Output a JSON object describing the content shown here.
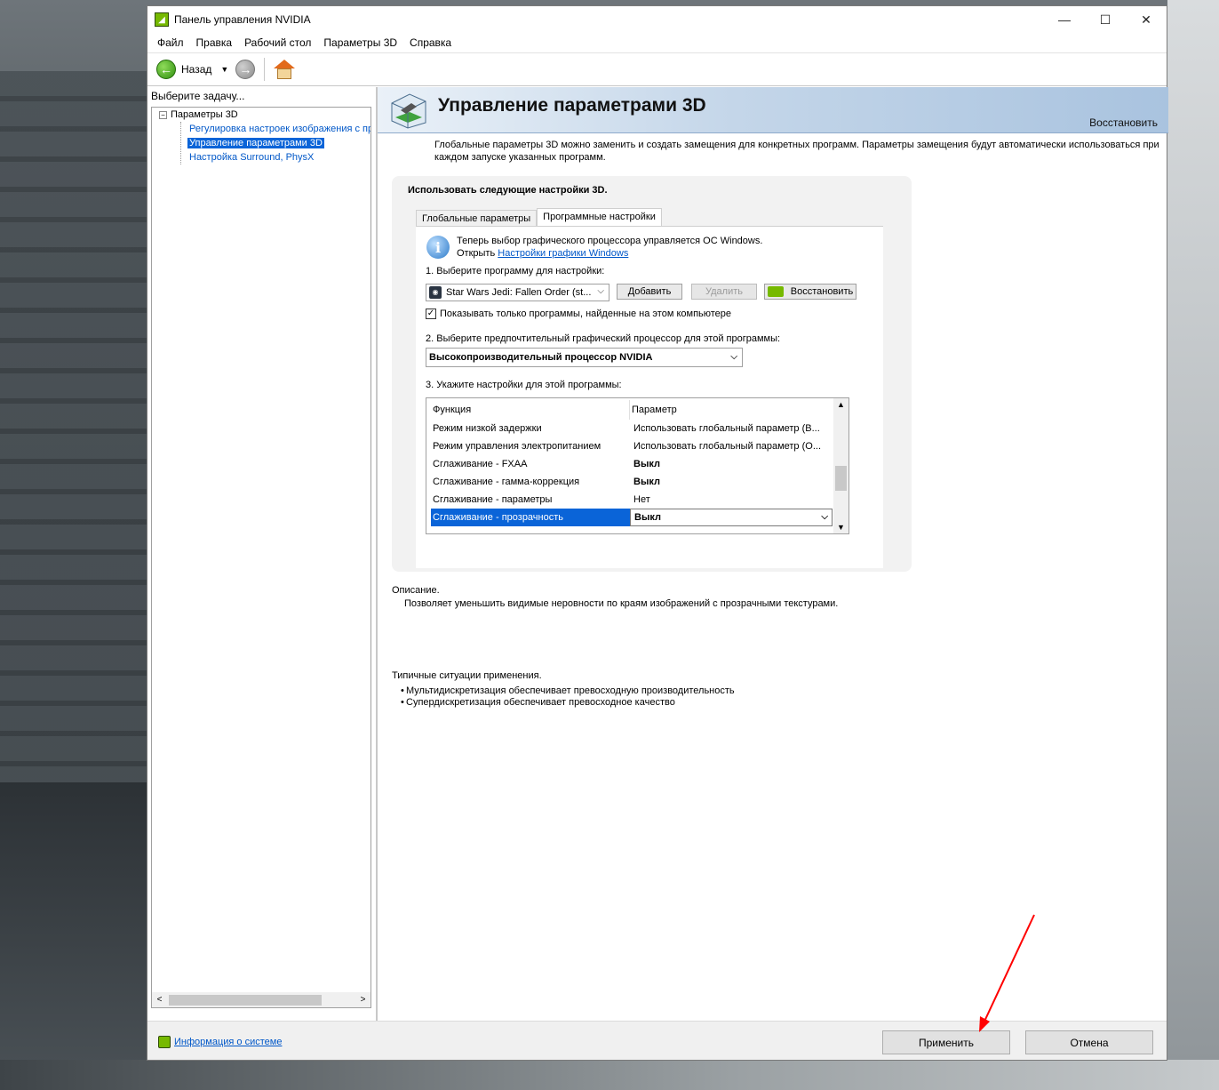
{
  "window": {
    "title": "Панель управления NVIDIA",
    "controls": {
      "minimize": "—",
      "maximize": "☐",
      "close": "✕"
    }
  },
  "menu": [
    "Файл",
    "Правка",
    "Рабочий стол",
    "Параметры 3D",
    "Справка"
  ],
  "toolbar": {
    "back_label": "Назад"
  },
  "sidebar": {
    "task_label": "Выберите задачу...",
    "root": "Параметры 3D",
    "items": [
      {
        "label": "Регулировка настроек изображения с пр"
      },
      {
        "label": "Управление параметрами 3D",
        "selected": true
      },
      {
        "label": "Настройка Surround, PhysX"
      }
    ]
  },
  "header": {
    "title": "Управление параметрами 3D",
    "restore": "Восстановить"
  },
  "intro": "Глобальные параметры 3D можно заменить и создать замещения для конкретных программ. Параметры замещения будут автоматически использоваться при каждом запуске указанных программ.",
  "settings": {
    "group_title": "Использовать следующие настройки 3D.",
    "tabs": [
      {
        "label": "Глобальные параметры",
        "active": false
      },
      {
        "label": "Программные настройки",
        "active": true
      }
    ],
    "info_line1": "Теперь выбор графического процессора управляется ОС Windows.",
    "info_open": "Открыть",
    "info_link": "Настройки графики Windows",
    "step1": "1. Выберите программу для настройки:",
    "program": "Star Wars Jedi: Fallen Order (st...",
    "add_button": "Добавить",
    "remove_button": "Удалить",
    "restore_button": "Восстановить",
    "checkbox_label": "Показывать только программы, найденные на этом компьютере",
    "checkbox_checked": true,
    "step2": "2. Выберите предпочтительный графический процессор для этой программы:",
    "gpu": "Высокопроизводительный процессор NVIDIA",
    "step3": "3. Укажите настройки для этой программы:",
    "table": {
      "headers": [
        "Функция",
        "Параметр"
      ],
      "rows": [
        {
          "feature": "Режим низкой задержки",
          "value": "Использовать глобальный параметр (В..."
        },
        {
          "feature": "Режим управления электропитанием",
          "value": "Использовать глобальный параметр (О..."
        },
        {
          "feature": "Сглаживание - FXAA",
          "value": "Выкл"
        },
        {
          "feature": "Сглаживание - гамма-коррекция",
          "value": "Выкл"
        },
        {
          "feature": "Сглаживание - параметры",
          "value": "Нет"
        },
        {
          "feature": "Сглаживание - прозрачность",
          "value": "Выкл"
        }
      ]
    }
  },
  "description": {
    "label": "Описание.",
    "text": "Позволяет уменьшить видимые неровности по краям изображений с прозрачными текстурами."
  },
  "usage": {
    "label": "Типичные ситуации применения.",
    "items": [
      "Мультидискретизация обеспечивает превосходную производительность",
      "Супердискретизация обеспечивает превосходное качество"
    ]
  },
  "footer": {
    "sysinfo": "Информация о системе",
    "apply": "Применить",
    "cancel": "Отмена"
  },
  "colors": {
    "accent": "#76b900",
    "selection": "#0a64d8",
    "link": "#0057c8",
    "annotation_arrow": "#ff0000"
  }
}
